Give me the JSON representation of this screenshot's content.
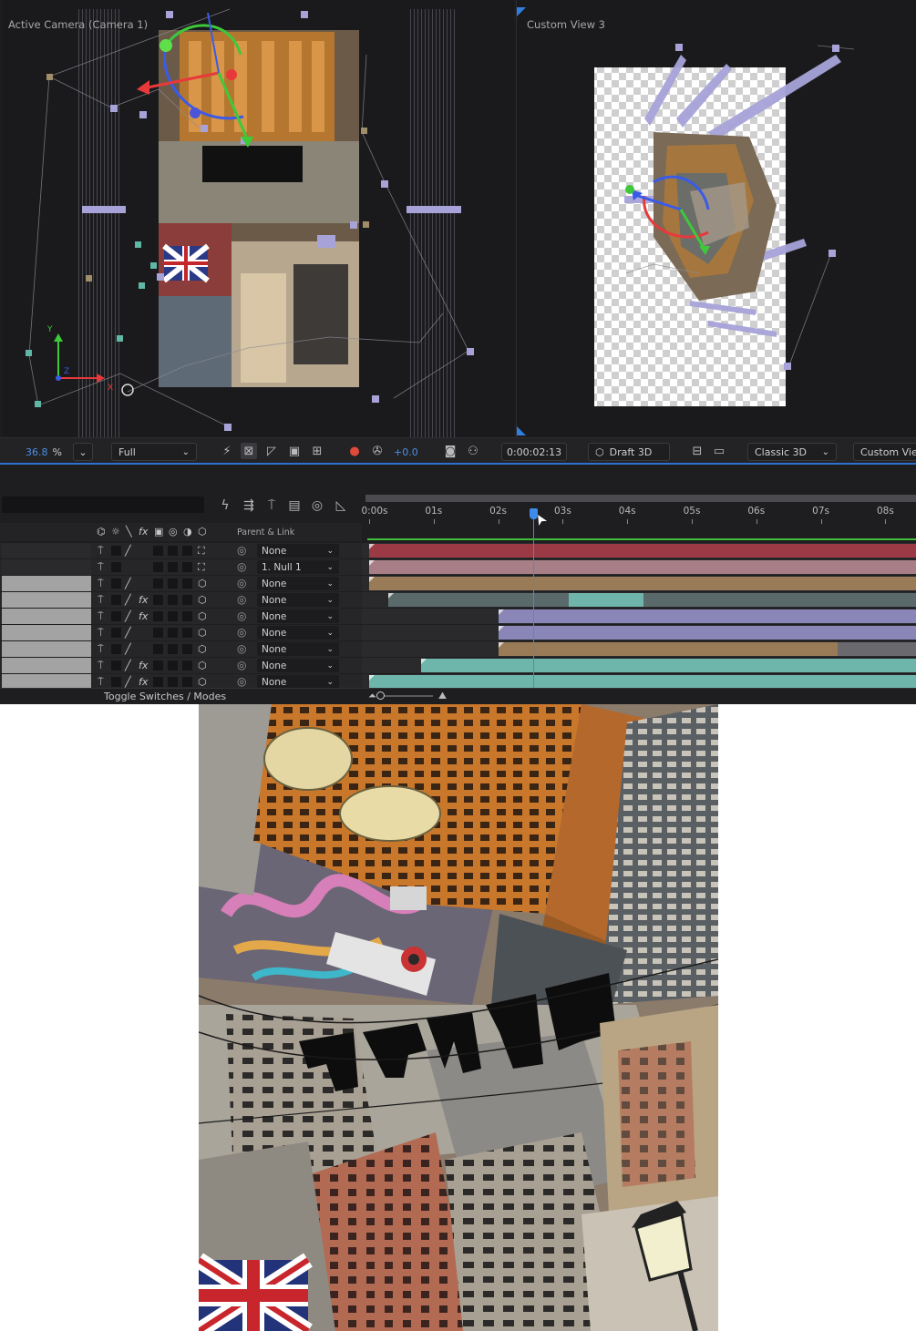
{
  "viewers": {
    "left": {
      "label": "Active Camera (Camera 1)"
    },
    "right": {
      "label": "Custom View 3"
    }
  },
  "toolbar": {
    "zoom_value": "36.8",
    "zoom_unit": "%",
    "resolution": "Full",
    "exposure": "+0.0",
    "timecode": "0:00:02:13",
    "draft_3d": "Draft 3D",
    "renderer": "Classic 3D",
    "view": "Custom Vie",
    "icons": [
      "fast-previews-icon",
      "transparency-grid-icon",
      "mask-visibility-icon",
      "roi-icon",
      "grid-guides-icon",
      "channel-icon",
      "reset-exposure-icon",
      "snapshot-icon",
      "show-snapshot-icon",
      "draft-3d-icon",
      "3d-ground-plane-icon",
      "3d-extended-viewer-icon"
    ]
  },
  "timeline": {
    "header_icons": [
      "motion-blur-icon",
      "shy-icon",
      "solo-icon",
      "frame-blend-icon",
      "graph-editor-icon",
      "composition-flowchart-icon"
    ],
    "switch_symbols": [
      "⌬",
      "☼",
      "╲",
      "fx",
      "▣",
      "◎",
      "◑",
      "⬡"
    ],
    "parent_link_label": "Parent & Link",
    "ruler_labels": [
      "0:00s",
      "01s",
      "02s",
      "03s",
      "04s",
      "05s",
      "06s",
      "07s",
      "08s"
    ],
    "footer": {
      "toggle_label": "Toggle Switches / Modes"
    },
    "layers": [
      {
        "swatch": "dark",
        "quality": "╱",
        "fx": "",
        "parent": "None",
        "bar_color": "#9b3a45",
        "bar_start": 0.0,
        "bar_end": 1.0
      },
      {
        "swatch": "dark",
        "quality": "",
        "fx": "",
        "parent": "1. Null 1",
        "bar_color": "#a87f86",
        "bar_start": 0.0,
        "bar_end": 1.0
      },
      {
        "swatch": "light",
        "quality": "╱",
        "fx": "",
        "parent": "None",
        "bar_color": "#9a7b58",
        "bar_start": 0.0,
        "bar_end": 1.0
      },
      {
        "swatch": "light",
        "quality": "╱",
        "fx": "fx",
        "parent": "None",
        "bar_color": "#5a6a6a",
        "bar_start": 0.3,
        "bar_end": 1.0,
        "highlight": "#70b5ab"
      },
      {
        "swatch": "light",
        "quality": "╱",
        "fx": "fx",
        "parent": "None",
        "bar_color": "#8a86b8",
        "bar_start": 2.0,
        "bar_end": 1.0
      },
      {
        "swatch": "light",
        "quality": "╱",
        "fx": "",
        "parent": "None",
        "bar_color": "#8a86b8",
        "bar_start": 2.0,
        "bar_end": 1.0
      },
      {
        "swatch": "light",
        "quality": "╱",
        "fx": "",
        "parent": "None",
        "bar_color": "#9a7b58",
        "bar_start": 2.0,
        "bar_end": 1.0
      },
      {
        "swatch": "light",
        "quality": "╱",
        "fx": "fx",
        "parent": "None",
        "bar_color": "#6eb5ab",
        "bar_start": 0.8,
        "bar_end": 1.0
      },
      {
        "swatch": "light",
        "quality": "╱",
        "fx": "fx",
        "parent": "None",
        "bar_color": "#6eb5ab",
        "bar_start": 0.0,
        "bar_end": 1.0
      }
    ]
  },
  "colors": {
    "accent_blue": "#3d8bea",
    "work_area_green": "#3fbe3a",
    "gizmo_red": "#e8393a",
    "gizmo_green": "#3ec93a",
    "gizmo_blue": "#3a5be8",
    "handle_lavender": "#a7a3d9"
  }
}
